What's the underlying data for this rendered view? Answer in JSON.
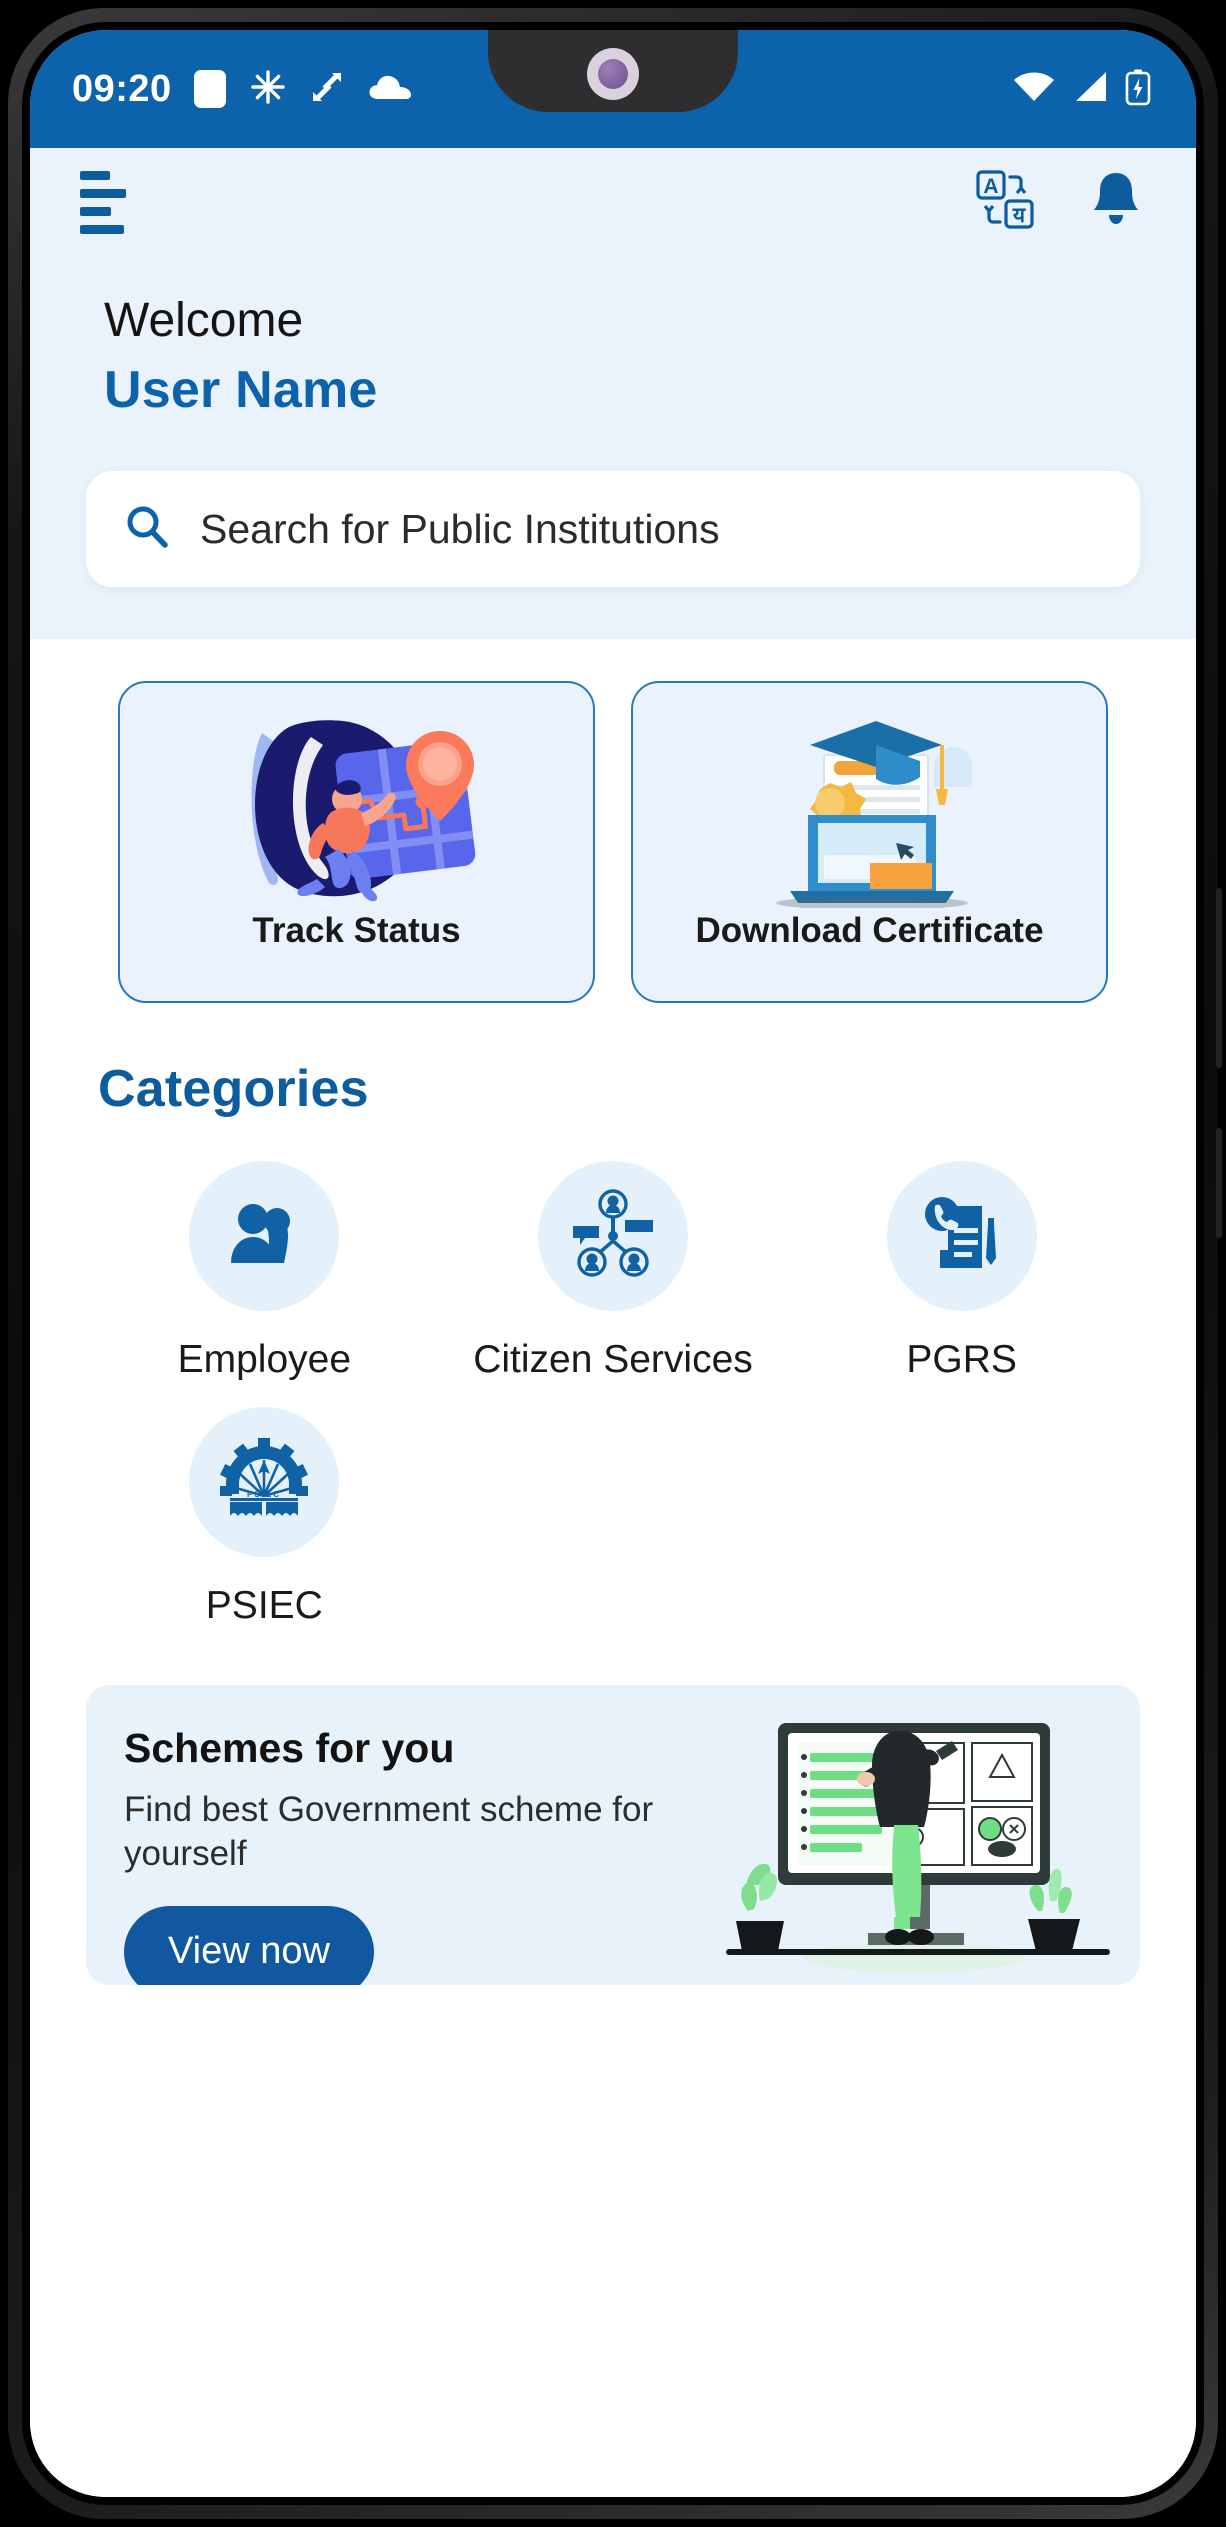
{
  "status_bar": {
    "time": "09:20",
    "left_icons": [
      "square-icon",
      "asterisk-icon",
      "screenshot-icon",
      "cloud-icon"
    ],
    "right_icons": [
      "wifi-icon",
      "signal-icon",
      "battery-icon"
    ],
    "background_color": "#0d63ab"
  },
  "app_bar": {
    "menu_icon": "hamburger-menu-icon",
    "translate_icon": "language-translate-icon",
    "notification_icon": "bell-icon",
    "accent_color": "#0d5c9e"
  },
  "greeting": {
    "welcome": "Welcome",
    "username": "User Name"
  },
  "search": {
    "placeholder": "Search for Public Institutions",
    "icon": "search-icon"
  },
  "quick_actions": [
    {
      "label": "Track Status",
      "icon": "track-status-illustration"
    },
    {
      "label": "Download Certificate",
      "icon": "download-certificate-illustration"
    }
  ],
  "categories": {
    "heading": "Categories",
    "items": [
      {
        "label": "Employee",
        "icon": "two-people-icon"
      },
      {
        "label": "Citizen Services",
        "icon": "people-network-icon"
      },
      {
        "label": "PGRS",
        "icon": "phone-document-pencil-icon"
      },
      {
        "label": "PSIEC",
        "icon": "psiec-gear-logo"
      }
    ]
  },
  "schemes_banner": {
    "title": "Schemes for you",
    "subtitle": "Find best Government scheme for yourself",
    "button_label": "View now",
    "illustration": "person-at-monitor-illustration",
    "button_color": "#1158a0",
    "background_color": "#e8f2fb"
  }
}
